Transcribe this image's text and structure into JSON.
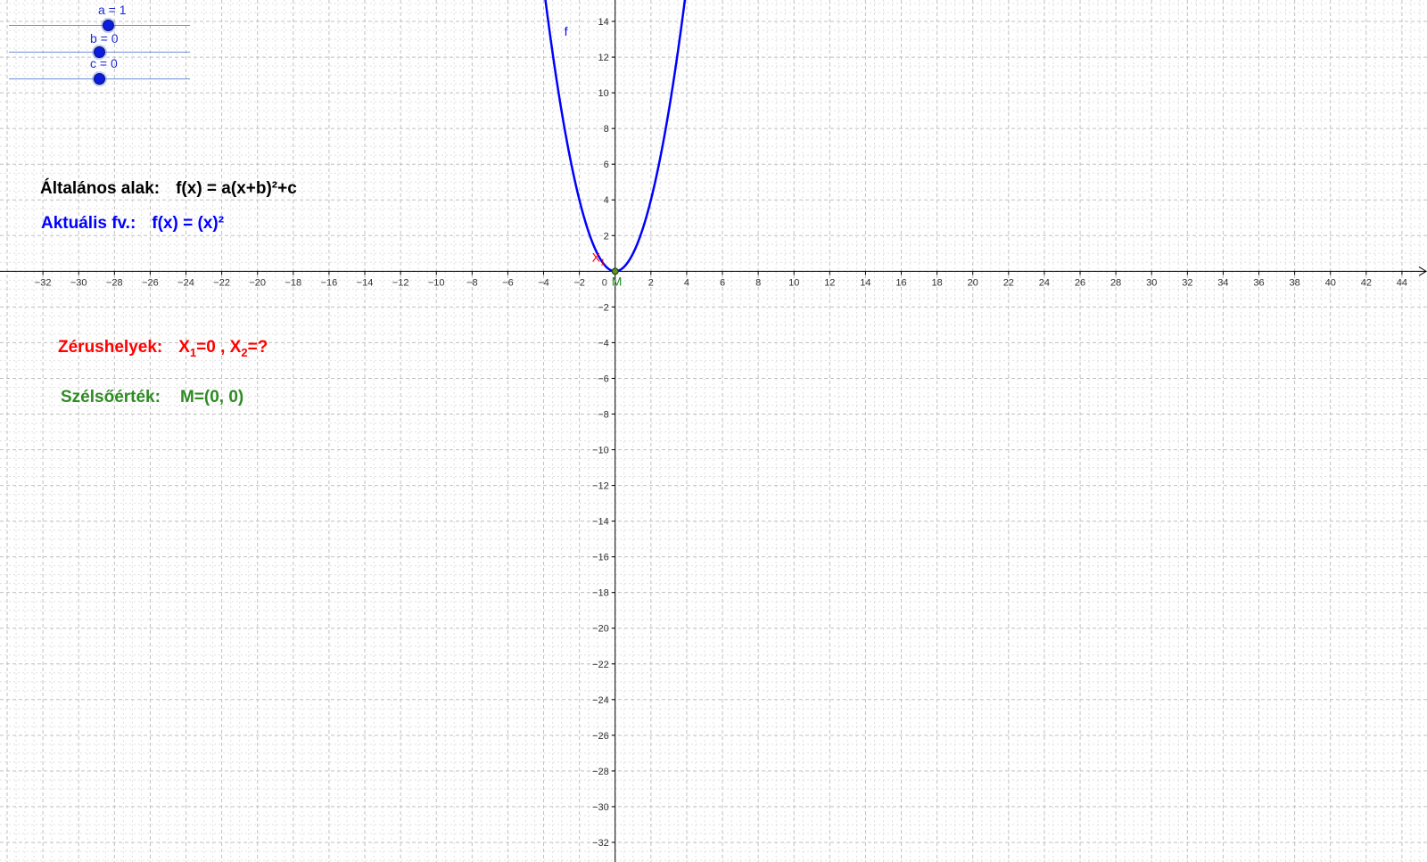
{
  "sliders": [
    {
      "label": "a = 1",
      "value": 1
    },
    {
      "label": "b = 0",
      "value": 0
    },
    {
      "label": "c = 0",
      "value": 0
    }
  ],
  "general_form": {
    "label": "Általános alak:",
    "formula": "f(x) = a(x+b)²+c"
  },
  "current_function": {
    "label": "Aktuális fv.:",
    "formula": "f(x) = (x)²"
  },
  "zeros": {
    "label": "Zérushelyek:",
    "x1_name": "X",
    "x1_sub": "1",
    "x1_value": "=0 ,",
    "x2_name": "X",
    "x2_sub": "2",
    "x2_value": "=?"
  },
  "extremum": {
    "label": "Szélsőérték:",
    "value": "M=(0, 0)"
  },
  "graph": {
    "function_name": "f",
    "point_x1_label": "X",
    "point_x1_sub": "1",
    "point_m_label": "M",
    "origin_label": "0",
    "x_ticks": [
      -32,
      -30,
      -28,
      -26,
      -24,
      -22,
      -20,
      -18,
      -16,
      -14,
      -12,
      -10,
      -8,
      -6,
      -4,
      -2,
      2,
      4,
      6,
      8,
      10,
      12,
      14,
      16,
      18,
      20,
      22,
      24,
      26,
      28,
      30,
      32,
      34,
      36,
      38,
      40,
      42,
      44
    ],
    "y_ticks": [
      14,
      12,
      10,
      8,
      6,
      4,
      2,
      -2,
      -4,
      -6,
      -8,
      -10,
      -12,
      -14,
      -16,
      -18,
      -20,
      -22,
      -24,
      -26,
      -28,
      -30,
      -32
    ],
    "x_range": [
      -34.4,
      45.4
    ],
    "y_range": [
      -33.1,
      15.2
    ],
    "colors": {
      "curve": "#0000ff",
      "zeros": "#ff0000",
      "extremum": "#228b22",
      "axis": "#000000",
      "grid_major": "#c0c0c0",
      "grid_minor": "#e0e0e0"
    }
  }
}
